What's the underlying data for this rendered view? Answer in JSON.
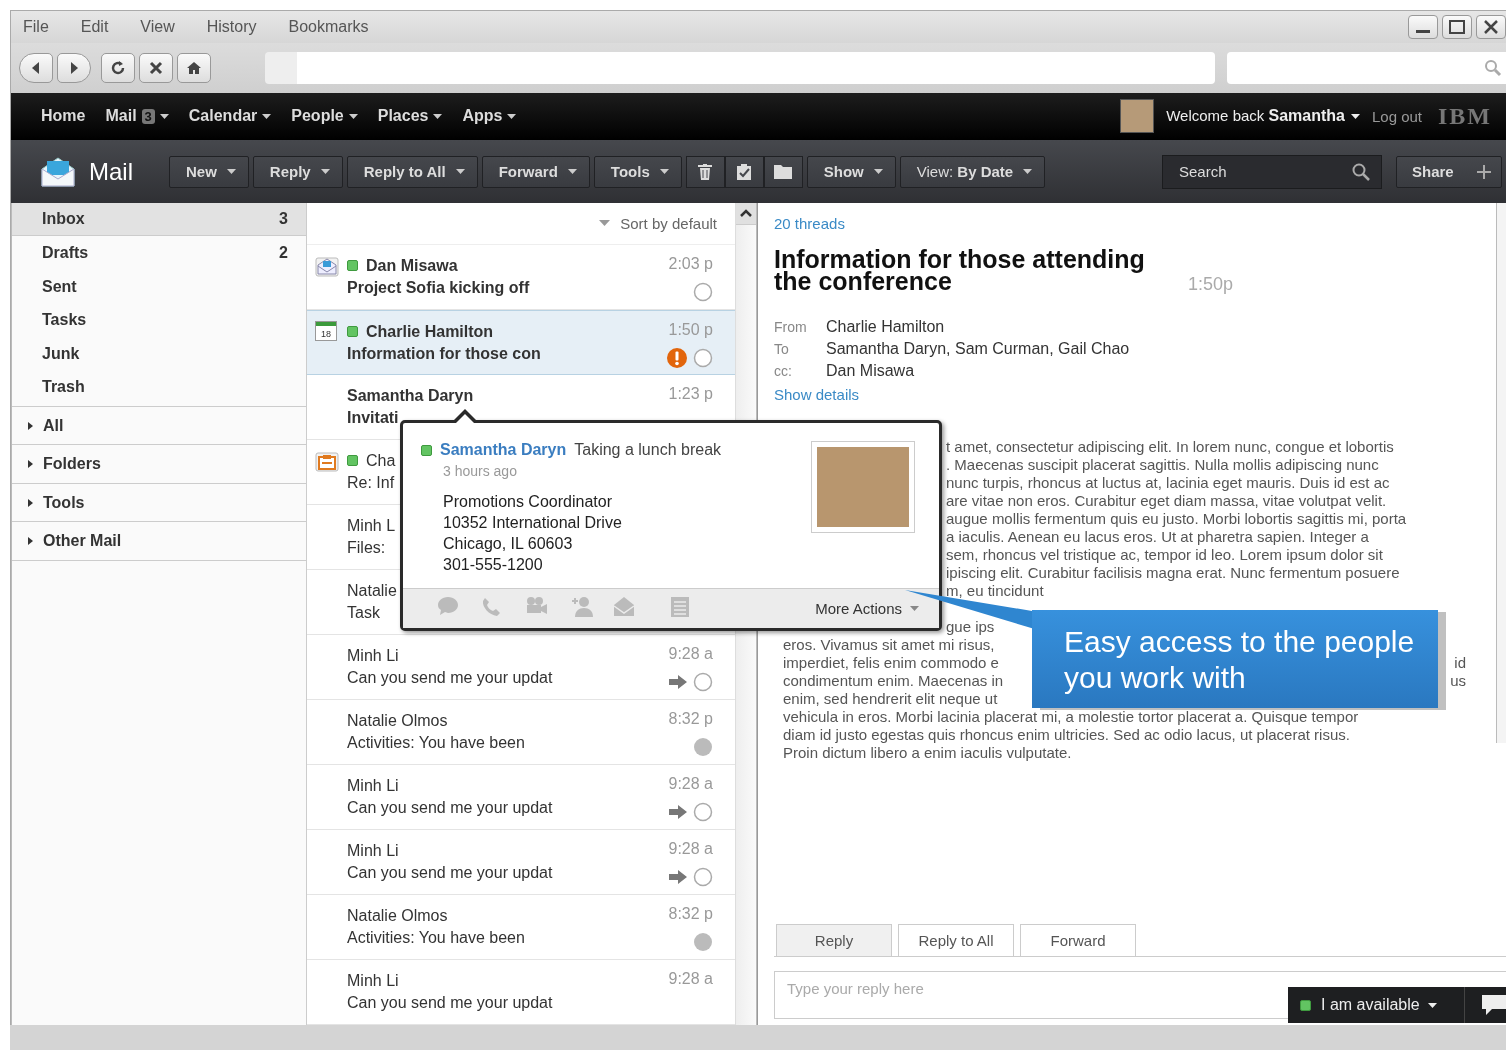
{
  "menu_bar": {
    "items": [
      "File",
      "Edit",
      "View",
      "History",
      "Bookmarks"
    ]
  },
  "top_nav": {
    "items": [
      {
        "label": "Home",
        "dropdown": false
      },
      {
        "label": "Mail",
        "badge": "3",
        "dropdown": true
      },
      {
        "label": "Calendar",
        "dropdown": true
      },
      {
        "label": "People",
        "dropdown": true
      },
      {
        "label": "Places",
        "dropdown": true
      },
      {
        "label": "Apps",
        "dropdown": true
      }
    ],
    "welcome": "Welcome back **Samantha**",
    "logout": "Log out",
    "logo": "IBM"
  },
  "toolbar": {
    "title": "Mail",
    "left_buttons": [
      "New",
      "Reply",
      "Reply to All",
      "Forward",
      "Tools"
    ],
    "right_buttons": [
      "Show",
      "View: **By Date**"
    ],
    "search": {
      "placeholder": "Search"
    },
    "share": "Share"
  },
  "sidebar": {
    "folders": [
      {
        "label": "Inbox",
        "count": "3",
        "selected": true
      },
      {
        "label": "Drafts",
        "count": "2",
        "selected": false
      },
      {
        "label": "Sent",
        "selected": false
      },
      {
        "label": "Tasks",
        "selected": false
      },
      {
        "label": "Junk",
        "selected": false
      },
      {
        "label": "Trash",
        "selected": false
      }
    ],
    "sections": [
      {
        "label": "All",
        "expanded": false
      },
      {
        "label": "Folders",
        "expanded": false
      },
      {
        "label": "Tools",
        "expanded": false
      },
      {
        "label": "Other Mail",
        "expanded": false
      }
    ]
  },
  "message_list": {
    "sort": "Sort by default",
    "rows": [
      {
        "icon": {
          "kind": "invite"
        },
        "online": true,
        "sender": "Dan Misawa",
        "subject": "Project Sofia kicking off",
        "time": "2:03 p",
        "unread": true,
        "selected": false,
        "important": false,
        "forwarded": false,
        "marker": {
          "kind": "ring"
        }
      },
      {
        "icon": {
          "kind": "calendar",
          "text": "18"
        },
        "online": true,
        "sender": "Charlie Hamilton",
        "subject": "Information for those con",
        "time": "1:50 p",
        "unread": true,
        "selected": true,
        "important": true,
        "forwarded": false,
        "marker": {
          "kind": "ring"
        }
      },
      {
        "online": false,
        "sender": "Samantha Daryn",
        "subject": "Invitati",
        "time": "1:23 p",
        "unread": true,
        "selected": false,
        "important": false,
        "forwarded": false
      },
      {
        "icon": {
          "kind": "task"
        },
        "online": true,
        "sender": "Cha",
        "subject": "Re: Inf",
        "unread": false,
        "selected": false,
        "important": false,
        "forwarded": false
      },
      {
        "online": false,
        "sender": "Minh L",
        "subject": "Files:",
        "unread": false,
        "selected": false,
        "important": false,
        "forwarded": false
      },
      {
        "online": false,
        "sender": "Natalie",
        "subject": "Task",
        "unread": false,
        "selected": false,
        "important": false,
        "forwarded": false
      },
      {
        "online": false,
        "sender": "Minh Li",
        "subject": "Can you send me your updat",
        "time": "9:28 a",
        "unread": false,
        "selected": false,
        "important": false,
        "forwarded": true,
        "marker": {
          "kind": "ring"
        }
      },
      {
        "online": false,
        "sender": "Natalie Olmos",
        "subject": "Activities: You have been",
        "time": "8:32 p",
        "unread": false,
        "selected": false,
        "important": false,
        "forwarded": false,
        "marker": {
          "kind": "dot"
        }
      },
      {
        "online": false,
        "sender": "Minh Li",
        "subject": "Can you send me your updat",
        "time": "9:28 a",
        "unread": false,
        "selected": false,
        "important": false,
        "forwarded": true,
        "marker": {
          "kind": "ring"
        }
      },
      {
        "online": false,
        "sender": "Minh Li",
        "subject": "Can you send me your updat",
        "time": "9:28 a",
        "unread": false,
        "selected": false,
        "important": false,
        "forwarded": true,
        "marker": {
          "kind": "ring"
        }
      },
      {
        "online": false,
        "sender": "Natalie Olmos",
        "subject": "Activities: You have been",
        "time": "8:32 p",
        "unread": false,
        "selected": false,
        "important": false,
        "forwarded": false,
        "marker": {
          "kind": "dot"
        }
      },
      {
        "online": false,
        "sender": "Minh Li",
        "subject": "Can you send me your updat",
        "time": "9:28 a",
        "unread": false,
        "selected": false,
        "important": false,
        "forwarded": false
      }
    ]
  },
  "reading_pane": {
    "thread_count": "20 threads",
    "subject": "Information for those attending the conference",
    "time": "1:50p",
    "headers": [
      {
        "label": "From",
        "value": "Charlie Hamilton"
      },
      {
        "label": "To",
        "value": "Samantha Daryn, Sam Curman, Gail Chao"
      },
      {
        "label": "cc:",
        "value": "Dan Misawa"
      }
    ],
    "show_details": "Show details",
    "body_beside_popup": [
      "t amet, consectetur adipiscing elit. In lorem nunc, congue et lobortis",
      ". Maecenas suscipit placerat sagittis. Nulla mollis adipiscing nunc",
      "nunc turpis, rhoncus at luctus at, lacinia eget mauris. Duis id est ac",
      "are vitae non eros. Curabitur eget diam massa, vitae volutpat velit.",
      "augue mollis fermentum quis eu justo. Morbi lobortis sagittis mi, porta",
      "a iaculis. Aenean eu lacus eros. Ut at pharetra sapien. Integer a",
      "sem, rhoncus vel tristique ac, tempor id leo. Lorem ipsum dolor sit",
      "ipiscing elit. Curabitur facilisis magna erat. Nunc fermentum posuere",
      "m, eu tincidunt"
    ],
    "body_partial_line": "gue ips",
    "body_below": [
      {
        "left": "eros. Vivamus sit amet mi risus,"
      },
      {
        "left": "imperdiet, felis enim commodo e",
        "right": "id"
      },
      {
        "left": "condimentum enim. Maecenas in",
        "right": "us"
      },
      {
        "left": "enim, sed hendrerit elit neque ut"
      },
      {
        "left": "vehicula in eros. Morbi lacinia placerat mi, a molestie tortor placerat a. Quisque tempor"
      },
      {
        "left": "diam id justo egestas quis rhoncus enim ultricies. Sed ac odio lacus, ut placerat risus."
      },
      {
        "left": "Proin dictum libero a enim iaculis vulputate."
      }
    ],
    "reply_tabs": [
      {
        "label": "Reply",
        "selected": true
      },
      {
        "label": "Reply to All",
        "selected": false
      },
      {
        "label": "Forward",
        "selected": false
      }
    ],
    "reply_placeholder": "Type your reply here"
  },
  "business_card": {
    "online": true,
    "name": "Samantha Daryn",
    "status": "Taking a lunch break",
    "time_ago": "3 hours ago",
    "details": [
      "Promotions Coordinator",
      "10352 International Drive",
      "Chicago, IL  60603",
      "301-555-1200"
    ],
    "more_actions": "More Actions"
  },
  "callout": {
    "text": "Easy access to the people you work with"
  },
  "chat_bar": {
    "online": true,
    "status": "I am available"
  }
}
